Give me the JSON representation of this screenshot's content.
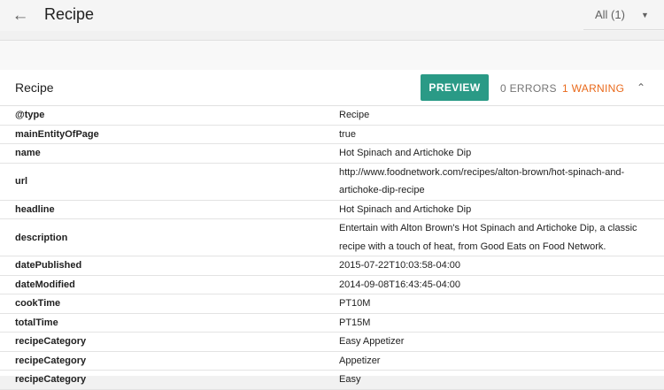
{
  "header": {
    "title": "Recipe",
    "filter_label": "All (1)"
  },
  "panel": {
    "title": "Recipe",
    "preview_label": "PREVIEW",
    "errors_label": "0 ERRORS",
    "warnings_label": "1 WARNING"
  },
  "rows": [
    {
      "key": "@type",
      "value": [
        "Recipe"
      ]
    },
    {
      "key": "mainEntityOfPage",
      "value": [
        "true"
      ]
    },
    {
      "key": "name",
      "value": [
        "Hot Spinach and Artichoke Dip"
      ]
    },
    {
      "key": "url",
      "value": [
        "http://www.foodnetwork.com/recipes/alton-brown/hot-spinach-and-",
        "artichoke-dip-recipe"
      ]
    },
    {
      "key": "headline",
      "value": [
        "Hot Spinach and Artichoke Dip"
      ]
    },
    {
      "key": "description",
      "value": [
        "Entertain with Alton Brown's Hot Spinach and Artichoke Dip, a classic",
        "recipe with a touch of heat, from Good Eats on Food Network."
      ]
    },
    {
      "key": "datePublished",
      "value": [
        "2015-07-22T10:03:58-04:00"
      ]
    },
    {
      "key": "dateModified",
      "value": [
        "2014-09-08T16:43:45-04:00"
      ]
    },
    {
      "key": "cookTime",
      "value": [
        "PT10M"
      ]
    },
    {
      "key": "totalTime",
      "value": [
        "PT15M"
      ]
    },
    {
      "key": "recipeCategory",
      "value": [
        "Easy Appetizer"
      ]
    },
    {
      "key": "recipeCategory",
      "value": [
        "Appetizer"
      ]
    },
    {
      "key": "recipeCategory",
      "value": [
        "Easy"
      ]
    }
  ]
}
